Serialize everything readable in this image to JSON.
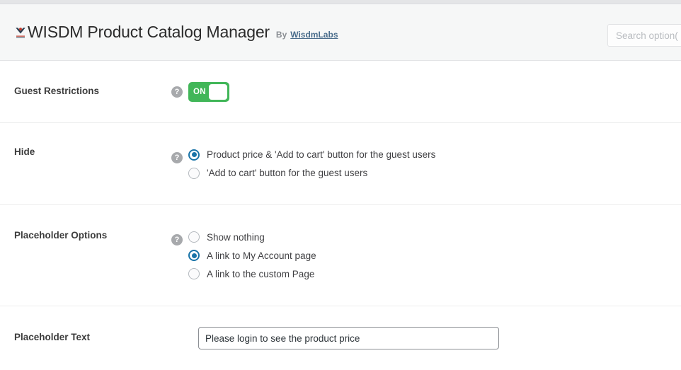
{
  "header": {
    "logo_icon": "wisdm-arrow-logo-icon",
    "title": "WISDM Product Catalog Manager",
    "by_label": "By",
    "vendor_link": "WisdmLabs",
    "search": {
      "placeholder": "Search option(",
      "value": "",
      "icon": "search-icon"
    }
  },
  "settings": {
    "help_icon_glyph": "?",
    "rows": [
      {
        "id": "guest-restrictions",
        "label": "Guest Restrictions",
        "type": "toggle",
        "toggle": {
          "state_label": "ON",
          "checked": true,
          "on_color": "#41b658",
          "knob_color": "#ffffff"
        }
      },
      {
        "id": "hide",
        "label": "Hide",
        "type": "radio-group",
        "options": [
          {
            "label": "Product price & 'Add to cart' button for the guest users",
            "checked": true
          },
          {
            "label": "'Add to cart' button for the guest users",
            "checked": false
          }
        ]
      },
      {
        "id": "placeholder-options",
        "label": "Placeholder Options",
        "type": "radio-group",
        "options": [
          {
            "label": "Show nothing",
            "checked": false
          },
          {
            "label": "A link to My Account page",
            "checked": true
          },
          {
            "label": "A link to the custom Page",
            "checked": false
          }
        ]
      },
      {
        "id": "placeholder-text",
        "label": "Placeholder Text",
        "type": "text",
        "input": {
          "value": "Please login to see the product price",
          "placeholder": "Please login to see the product price"
        }
      }
    ]
  },
  "colors": {
    "accent_blue": "#1a74a8",
    "toggle_green": "#41b658",
    "help_gray": "#a7a9ac",
    "header_bg": "#f6f7f7"
  }
}
